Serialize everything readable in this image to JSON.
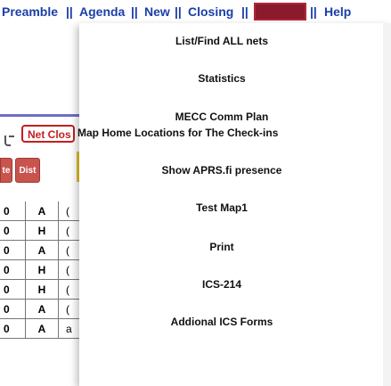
{
  "topbar": {
    "items": [
      "Preamble",
      "Agenda",
      "New",
      "Closing",
      "Reports",
      "Help"
    ],
    "separator": "||"
  },
  "background": {
    "net_close_button": "Net Clos",
    "button_bar": [
      "te",
      "Dist"
    ],
    "grid_rows": [
      [
        "0",
        "A",
        "("
      ],
      [
        "0",
        "H",
        "("
      ],
      [
        "0",
        "A",
        "("
      ],
      [
        "0",
        "H",
        "("
      ],
      [
        "0",
        "H",
        "("
      ],
      [
        "0",
        "A",
        "("
      ],
      [
        "0",
        "A",
        "a"
      ]
    ]
  },
  "menu": {
    "items": [
      "List/Find ALL nets",
      "Statistics",
      "MECC Comm Plan",
      "Map Home Locations for The Check-ins",
      "Show APRS.fi presence",
      "Test Map1",
      "Print",
      "ICS-214",
      "Addional ICS Forms"
    ]
  },
  "colors": {
    "menu_text": "#1b3fa8",
    "highlight": "#8b1a2a",
    "net_close_border": "#c41e1e",
    "button_red": "#c9534d",
    "yellow_bar": "#e3c229"
  }
}
